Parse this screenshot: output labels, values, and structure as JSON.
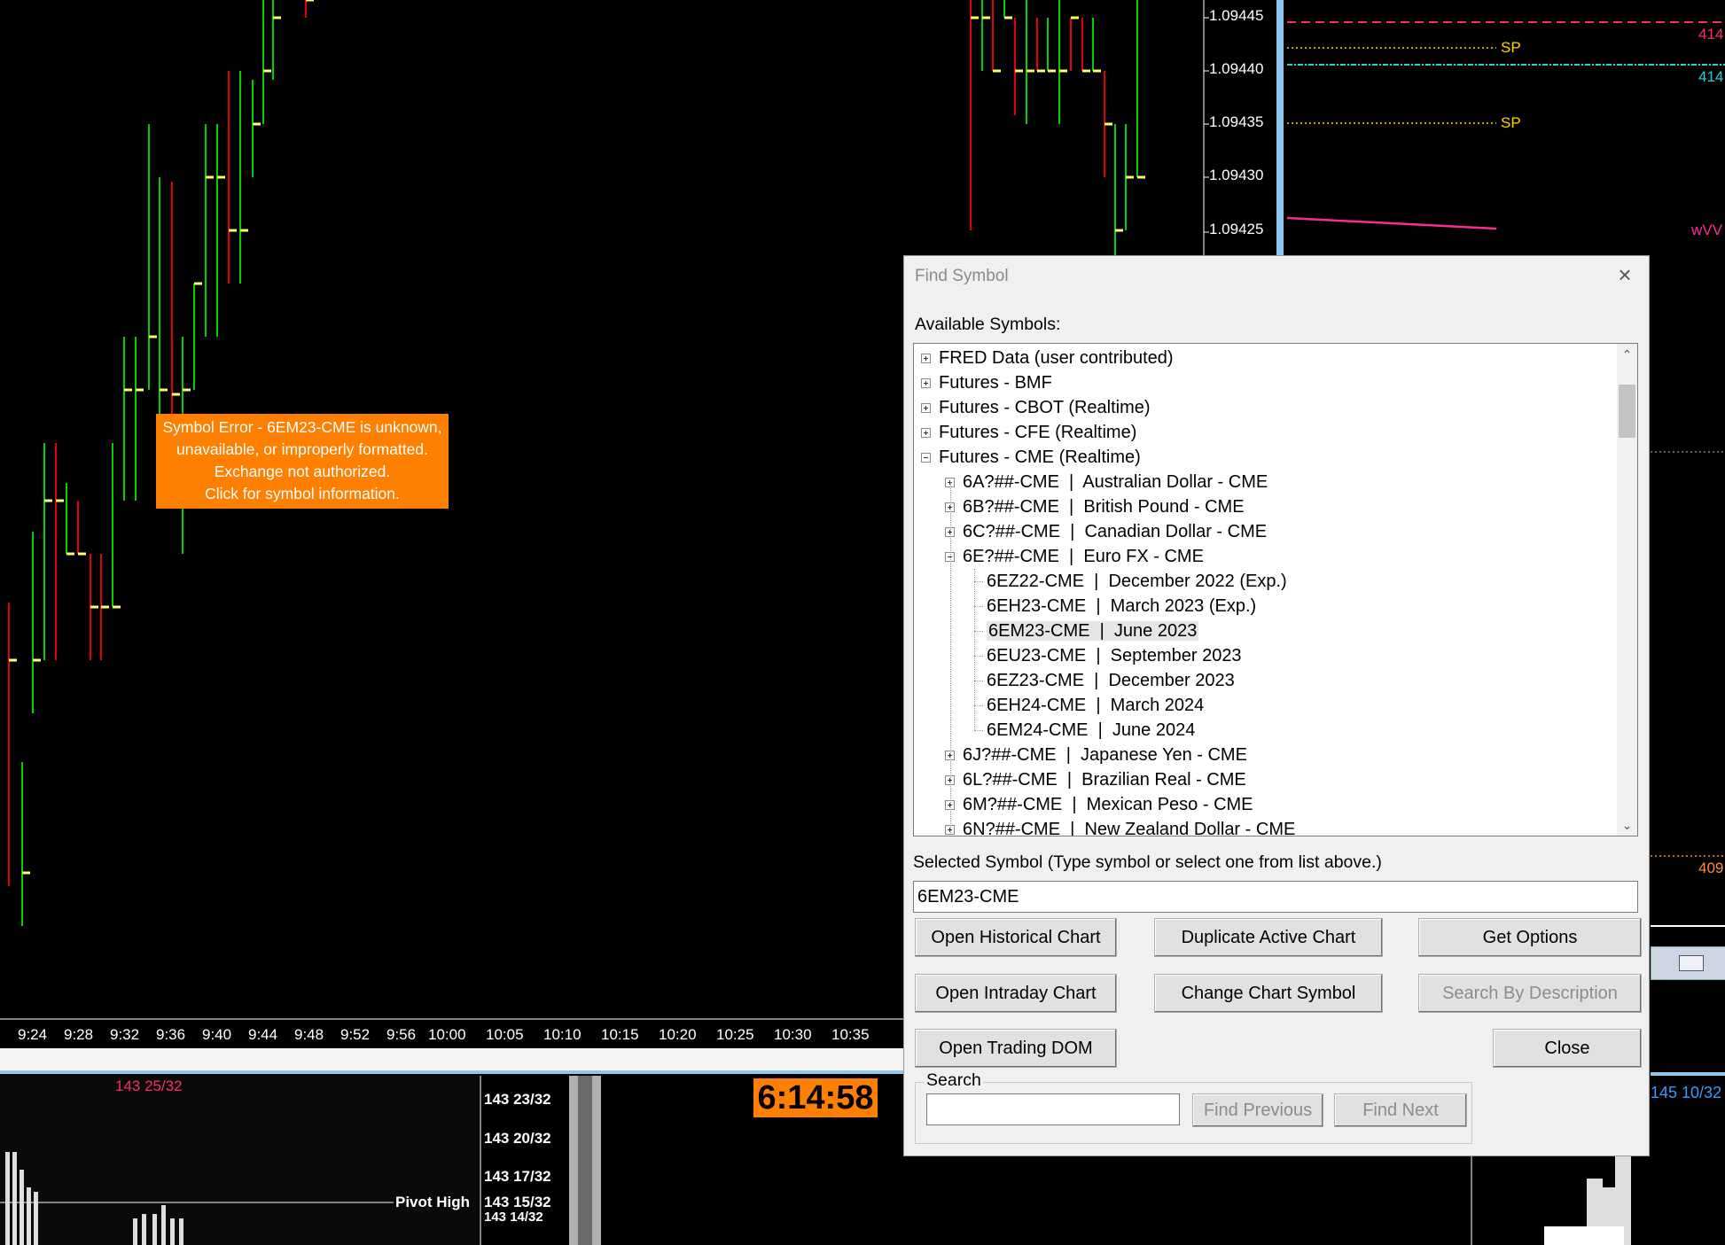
{
  "chart": {
    "price_labels": [
      "1.09445",
      "1.09440",
      "1.09435",
      "1.09430",
      "1.09425"
    ],
    "time_labels": [
      "9:24",
      "9:28",
      "9:32",
      "9:36",
      "9:40",
      "9:44",
      "9:48",
      "9:52",
      "9:56",
      "10:00",
      "10:05",
      "10:10",
      "10:15",
      "10:20",
      "10:25",
      "10:30",
      "10:35"
    ],
    "right_panel": {
      "labels": [
        "SP",
        "SP"
      ],
      "edge_values": [
        "414",
        "414",
        "409",
        "wVV"
      ]
    },
    "sub_chart": {
      "price_labels": [
        "143 23/32",
        "143 20/32",
        "143 17/32",
        "143 15/32",
        "143 14/32"
      ],
      "top_label": "143 25/32",
      "pivot_label": "Pivot High",
      "right_value": "145 10/32"
    },
    "timer": "6:14:58",
    "colors": {
      "up": "#00d000",
      "down": "#e00000",
      "close_tick": "#ffff66",
      "accent": "#ff7f00"
    }
  },
  "symbol_error": {
    "lines": [
      "Symbol Error - 6EM23-CME is unknown,",
      "unavailable, or improperly formatted.",
      "Exchange not authorized.",
      "Click for symbol information."
    ]
  },
  "dialog": {
    "title": "Find Symbol",
    "available_label": "Available Symbols:",
    "tree": [
      {
        "label": "FRED Data (user contributed)",
        "level": 0,
        "expander": "plus"
      },
      {
        "label": "Futures - BMF",
        "level": 0,
        "expander": "plus"
      },
      {
        "label": "Futures - CBOT (Realtime)",
        "level": 0,
        "expander": "plus"
      },
      {
        "label": "Futures - CFE (Realtime)",
        "level": 0,
        "expander": "plus"
      },
      {
        "label": "Futures - CME (Realtime)",
        "level": 0,
        "expander": "minus"
      },
      {
        "label": "6A?##-CME  |  Australian Dollar - CME",
        "level": 1,
        "expander": "plus"
      },
      {
        "label": "6B?##-CME  |  British Pound - CME",
        "level": 1,
        "expander": "plus"
      },
      {
        "label": "6C?##-CME  |  Canadian Dollar - CME",
        "level": 1,
        "expander": "plus"
      },
      {
        "label": "6E?##-CME  |  Euro FX - CME",
        "level": 1,
        "expander": "minus"
      },
      {
        "label": "6EZ22-CME  |  December 2022 (Exp.)",
        "level": 2,
        "expander": "none"
      },
      {
        "label": "6EH23-CME  |  March 2023 (Exp.)",
        "level": 2,
        "expander": "none"
      },
      {
        "label": "6EM23-CME  |  June 2023",
        "level": 2,
        "expander": "none",
        "selected": true
      },
      {
        "label": "6EU23-CME  |  September 2023",
        "level": 2,
        "expander": "none"
      },
      {
        "label": "6EZ23-CME  |  December 2023",
        "level": 2,
        "expander": "none"
      },
      {
        "label": "6EH24-CME  |  March 2024",
        "level": 2,
        "expander": "none"
      },
      {
        "label": "6EM24-CME  |  June 2024",
        "level": 2,
        "expander": "none"
      },
      {
        "label": "6J?##-CME  |  Japanese Yen - CME",
        "level": 1,
        "expander": "plus"
      },
      {
        "label": "6L?##-CME  |  Brazilian Real - CME",
        "level": 1,
        "expander": "plus"
      },
      {
        "label": "6M?##-CME  |  Mexican Peso - CME",
        "level": 1,
        "expander": "plus"
      },
      {
        "label": "6N?##-CME  |  New Zealand Dollar - CME",
        "level": 1,
        "expander": "plus"
      }
    ],
    "selected_label": "Selected Symbol (Type symbol or select one from list above.)",
    "selected_value": "6EM23-CME",
    "buttons": {
      "open_historical": "Open Historical Chart",
      "duplicate_active": "Duplicate Active Chart",
      "get_options": "Get Options",
      "open_intraday": "Open Intraday Chart",
      "change_symbol": "Change Chart Symbol",
      "search_by_description": "Search By Description",
      "open_dom": "Open Trading DOM",
      "close": "Close",
      "find_previous": "Find Previous",
      "find_next": "Find Next"
    },
    "search_label": "Search",
    "search_value": ""
  }
}
